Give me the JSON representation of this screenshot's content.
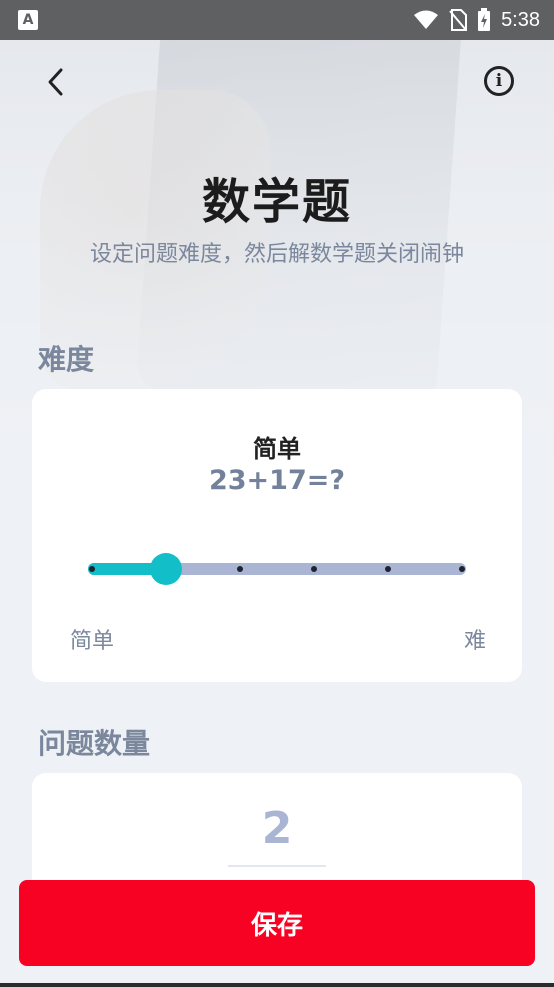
{
  "status_bar": {
    "notification_icon": "A",
    "time": "5:38",
    "icons": [
      "wifi-icon",
      "no-sim-icon",
      "battery-charging-icon"
    ]
  },
  "header": {
    "back_icon": "chevron-left-icon",
    "info_icon": "info-icon",
    "info_glyph": "i",
    "title": "数学题",
    "subtitle": "设定问题难度，然后解数学题关闭闹钟"
  },
  "difficulty": {
    "section_label": "难度",
    "level_label": "简单",
    "example": "23+17=?",
    "slider": {
      "steps": 6,
      "selected_index": 1
    },
    "min_label": "简单",
    "max_label": "难"
  },
  "question_count": {
    "section_label": "问题数量",
    "value": "2"
  },
  "footer": {
    "save_label": "保存"
  },
  "colors": {
    "accent": "#12bfc8",
    "track": "#aab5d4",
    "primary_button": "#f80224",
    "label_gray": "#7b879c"
  }
}
